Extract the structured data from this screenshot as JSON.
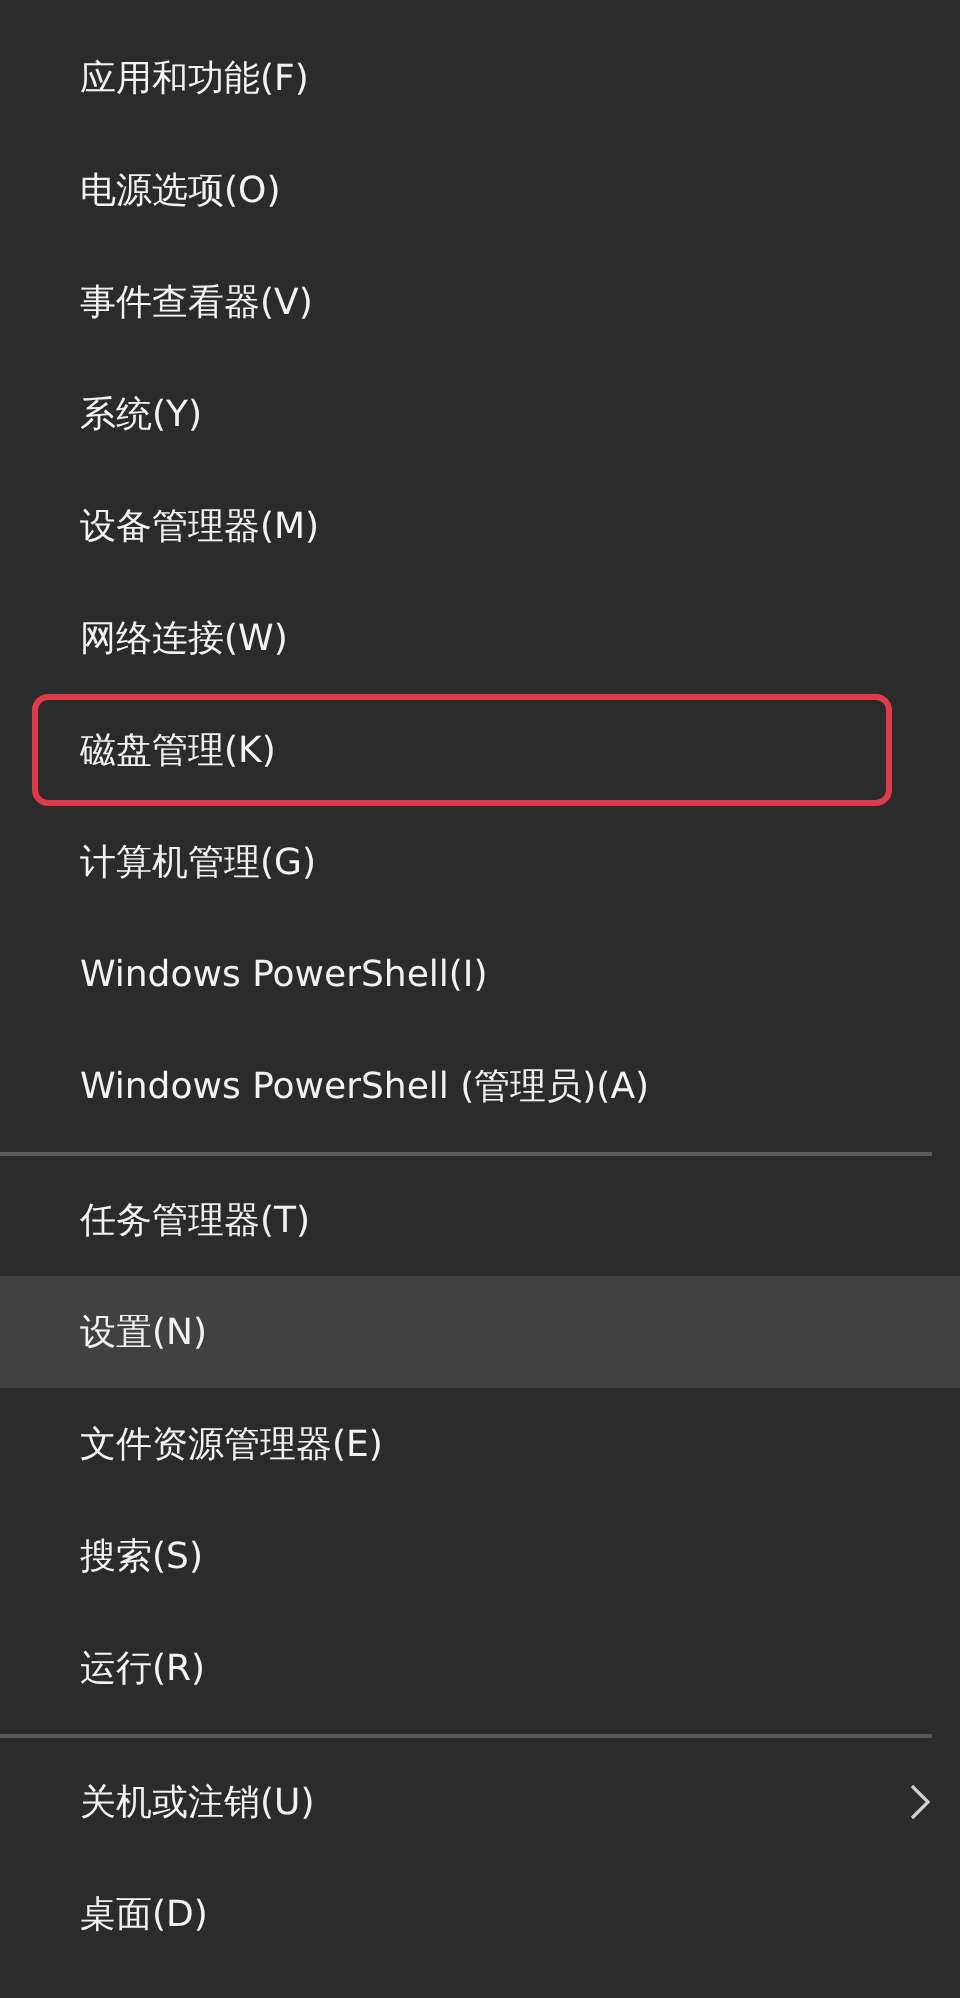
{
  "menu": {
    "groups": [
      {
        "items": [
          {
            "label": "应用和功能(F)",
            "selected": false,
            "highlighted": false,
            "submenu": false
          },
          {
            "label": "电源选项(O)",
            "selected": false,
            "highlighted": false,
            "submenu": false
          },
          {
            "label": "事件查看器(V)",
            "selected": false,
            "highlighted": false,
            "submenu": false
          },
          {
            "label": "系统(Y)",
            "selected": false,
            "highlighted": false,
            "submenu": false
          },
          {
            "label": "设备管理器(M)",
            "selected": false,
            "highlighted": false,
            "submenu": false
          },
          {
            "label": "网络连接(W)",
            "selected": false,
            "highlighted": false,
            "submenu": false
          },
          {
            "label": "磁盘管理(K)",
            "selected": false,
            "highlighted": true,
            "submenu": false
          },
          {
            "label": "计算机管理(G)",
            "selected": false,
            "highlighted": false,
            "submenu": false
          },
          {
            "label": "Windows PowerShell(I)",
            "selected": false,
            "highlighted": false,
            "submenu": false
          },
          {
            "label": "Windows PowerShell (管理员)(A)",
            "selected": false,
            "highlighted": false,
            "submenu": false
          }
        ]
      },
      {
        "items": [
          {
            "label": "任务管理器(T)",
            "selected": false,
            "highlighted": false,
            "submenu": false
          },
          {
            "label": "设置(N)",
            "selected": true,
            "highlighted": false,
            "submenu": false
          },
          {
            "label": "文件资源管理器(E)",
            "selected": false,
            "highlighted": false,
            "submenu": false
          },
          {
            "label": "搜索(S)",
            "selected": false,
            "highlighted": false,
            "submenu": false
          },
          {
            "label": "运行(R)",
            "selected": false,
            "highlighted": false,
            "submenu": false
          }
        ]
      },
      {
        "items": [
          {
            "label": "关机或注销(U)",
            "selected": false,
            "highlighted": false,
            "submenu": true
          },
          {
            "label": "桌面(D)",
            "selected": false,
            "highlighted": false,
            "submenu": false
          }
        ]
      }
    ]
  }
}
